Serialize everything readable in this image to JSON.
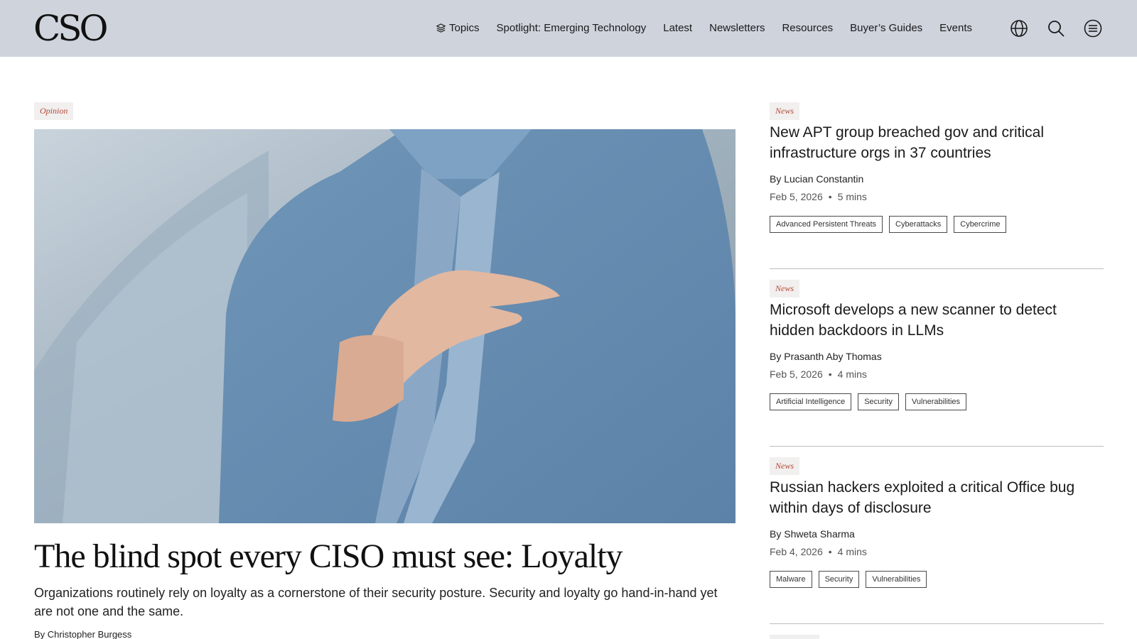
{
  "header": {
    "logo": "CSO",
    "nav": [
      "Topics",
      "Spotlight: Emerging Technology",
      "Latest",
      "Newsletters",
      "Resources",
      "Buyer’s Guides",
      "Events"
    ],
    "icons": [
      "globe-icon",
      "search-icon",
      "menu-icon"
    ]
  },
  "feature": {
    "badge": "Opinion",
    "title": "The blind spot every CISO must see: Loyalty",
    "dek": "Organizations routinely rely on loyalty as a cornerstone of their security posture. Security and loyalty go hand-in-hand yet are not one and the same.",
    "byline": "By Christopher Burgess"
  },
  "stories": [
    {
      "badge": "News",
      "title": "New APT group breached gov and critical infrastructure orgs in 37 countries",
      "byline": "By Lucian Constantin",
      "date": "Feb 5, 2026",
      "read_time": "5 mins",
      "tags": [
        "Advanced Persistent Threats",
        "Cyberattacks",
        "Cybercrime"
      ]
    },
    {
      "badge": "News",
      "title": "Microsoft develops a new scanner to detect hidden backdoors in LLMs",
      "byline": "By Prasanth Aby Thomas",
      "date": "Feb 5, 2026",
      "read_time": "4 mins",
      "tags": [
        "Artificial Intelligence",
        "Security",
        "Vulnerabilities"
      ]
    },
    {
      "badge": "News",
      "title": "Russian hackers exploited a critical Office bug within days of disclosure",
      "byline": "By Shweta Sharma",
      "date": "Feb 4, 2026",
      "read_time": "4 mins",
      "tags": [
        "Malware",
        "Security",
        "Vulnerabilities"
      ]
    }
  ],
  "colors": {
    "header_bg": "#cfd3dc",
    "badge_bg": "#f2efef",
    "badge_text": "#b24a34"
  }
}
